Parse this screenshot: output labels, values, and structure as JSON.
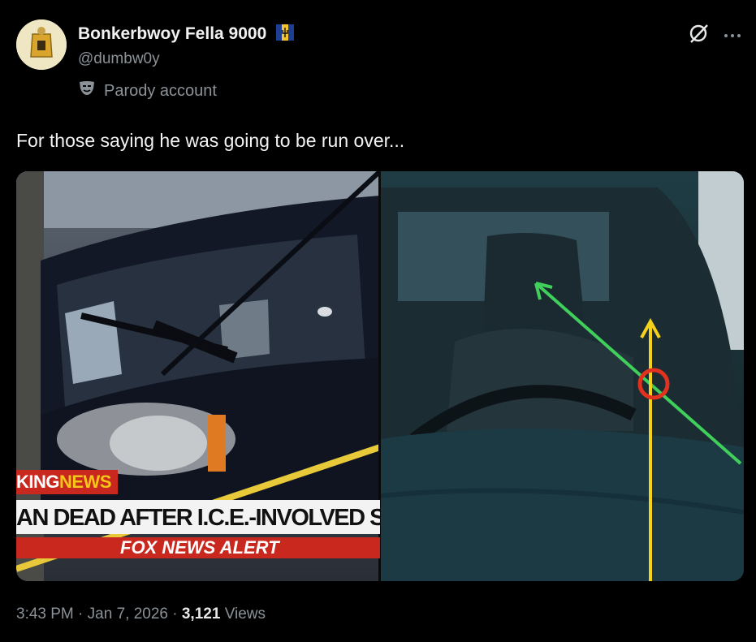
{
  "post": {
    "display_name": "Bonkerbwoy Fella 9000",
    "handle": "@dumbw0y",
    "parody_label": "Parody account",
    "text": "For those saying he was going to be run over...",
    "time": "3:43 PM",
    "separator": "·",
    "date": "Jan 7, 2026",
    "views_count": "3,121",
    "views_label": "Views"
  },
  "media": {
    "ticker_label_part1": "KING",
    "ticker_label_part2": "NEWS",
    "headline": "AN DEAD AFTER I.C.E.-INVOLVED SHOO",
    "alert_text": "FOX NEWS ALERT"
  },
  "icons": {
    "flag": "barbados-flag-icon",
    "parody": "theater-mask-icon",
    "grok": "grok-icon",
    "more": "more-icon"
  },
  "colors": {
    "background": "#000000",
    "secondary_text": "#8b9298",
    "arrow_green": "#3fcf5a",
    "arrow_yellow": "#f5d21a",
    "circle_red": "#e2321f",
    "fox_red": "#c8281e"
  }
}
